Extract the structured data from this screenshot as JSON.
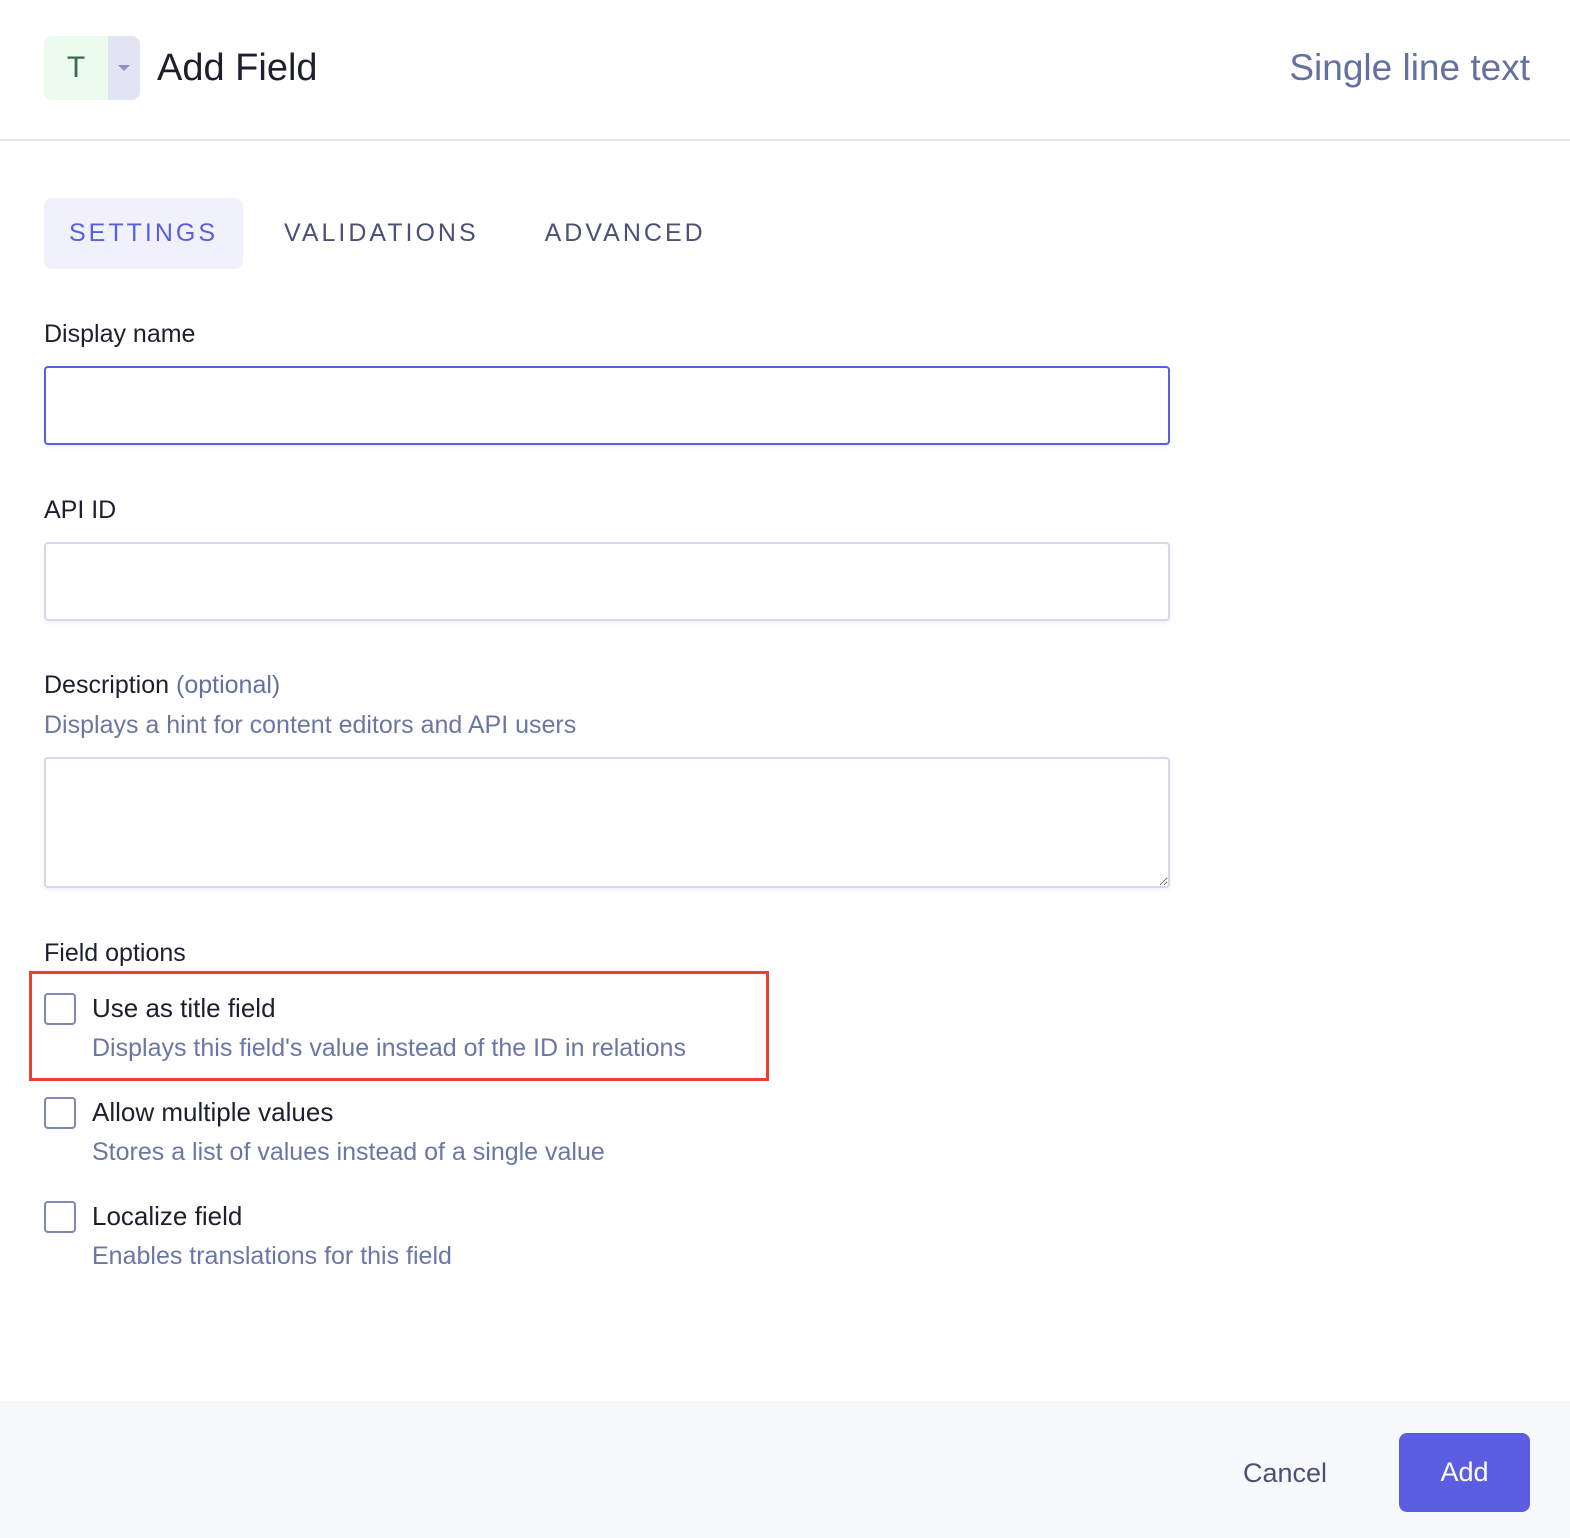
{
  "header": {
    "type_icon_letter": "T",
    "title": "Add Field",
    "field_type": "Single line text"
  },
  "tabs": [
    {
      "label": "SETTINGS",
      "active": true
    },
    {
      "label": "VALIDATIONS",
      "active": false
    },
    {
      "label": "ADVANCED",
      "active": false
    }
  ],
  "form": {
    "display_name": {
      "label": "Display name",
      "value": ""
    },
    "api_id": {
      "label": "API ID",
      "value": ""
    },
    "description": {
      "label": "Description",
      "optional_label": "(optional)",
      "hint": "Displays a hint for content editors and API users",
      "value": ""
    },
    "field_options": {
      "heading": "Field options",
      "options": [
        {
          "label": "Use as title field",
          "description": "Displays this field's value instead of the ID in relations",
          "checked": false
        },
        {
          "label": "Allow multiple values",
          "description": "Stores a list of values instead of a single value",
          "checked": false
        },
        {
          "label": "Localize field",
          "description": "Enables translations for this field",
          "checked": false
        }
      ]
    }
  },
  "footer": {
    "cancel_label": "Cancel",
    "add_label": "Add"
  },
  "colors": {
    "accent": "#5b5ee1",
    "highlight": "#e5432b",
    "muted_text": "#6b77a3"
  }
}
